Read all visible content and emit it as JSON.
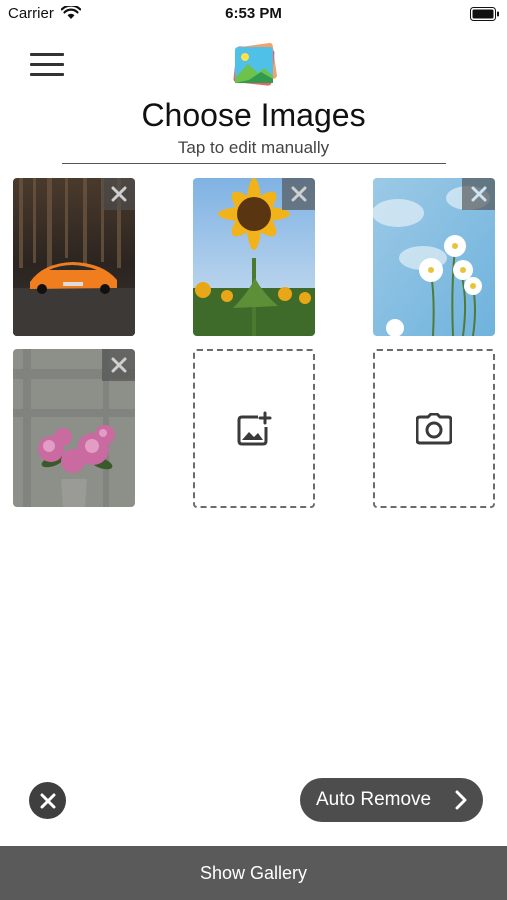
{
  "status_bar": {
    "carrier": "Carrier",
    "time": "6:53 PM"
  },
  "header": {
    "title": "Choose Images",
    "subtitle": "Tap to edit manually"
  },
  "images": [
    {
      "description_icon": "sports-car-photo",
      "removable": true
    },
    {
      "description_icon": "sunflower-photo",
      "removable": true
    },
    {
      "description_icon": "white-flowers-photo",
      "removable": true
    },
    {
      "description_icon": "pink-peonies-photo",
      "removable": true
    }
  ],
  "actions": {
    "add_image_icon": "add-photo-icon",
    "camera_icon": "camera-icon",
    "auto_remove_label": "Auto Remove",
    "show_gallery_label": "Show Gallery"
  },
  "colors": {
    "dark_button": "#4d4d4d",
    "bottom_bar": "#5a5a5a",
    "remove_overlay": "#505050",
    "car_orange": "#f07d1e",
    "sunflower_yellow": "#f2b21a",
    "sky_blue": "#8cc4e6"
  }
}
